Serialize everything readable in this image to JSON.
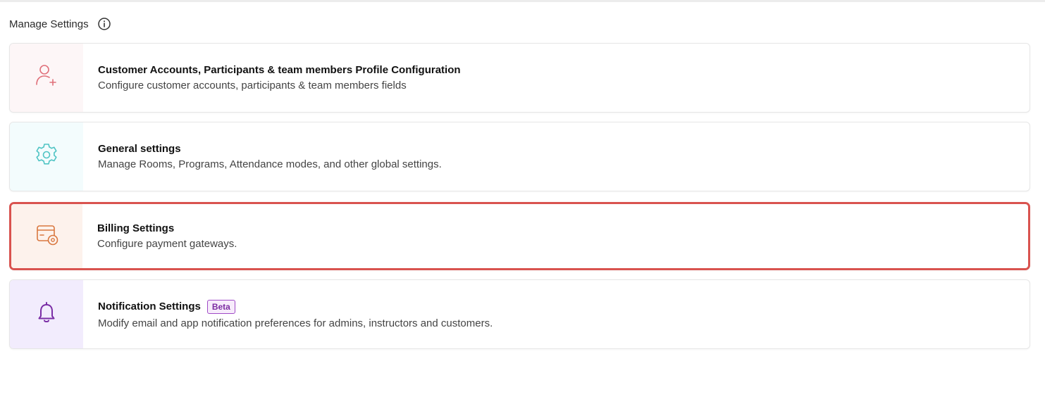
{
  "header": {
    "title": "Manage Settings",
    "info_icon": "info-icon"
  },
  "cards": [
    {
      "title": "Customer Accounts, Participants & team members Profile Configuration",
      "description": "Configure customer accounts, participants & team members fields",
      "icon": "user-add-icon",
      "icon_color": "#e0707a",
      "icon_bg": "#fdf6f7"
    },
    {
      "title": "General settings",
      "description": "Manage Rooms, Programs, Attendance modes, and other global settings.",
      "icon": "gear-icon",
      "icon_color": "#4fc4c4",
      "icon_bg": "#f3fcfd"
    },
    {
      "title": "Billing Settings",
      "description": "Configure payment gateways.",
      "icon": "billing-settings-icon",
      "icon_color": "#d9773f",
      "icon_bg": "#fdf2ec",
      "selected": true
    },
    {
      "title": "Notification Settings",
      "badge": "Beta",
      "description": "Modify email and app notification preferences for admins, instructors and customers.",
      "icon": "bell-icon",
      "icon_color": "#7a2ea6",
      "icon_bg": "#f2ecfd"
    }
  ],
  "colors": {
    "selected_border": "#d9534f"
  }
}
